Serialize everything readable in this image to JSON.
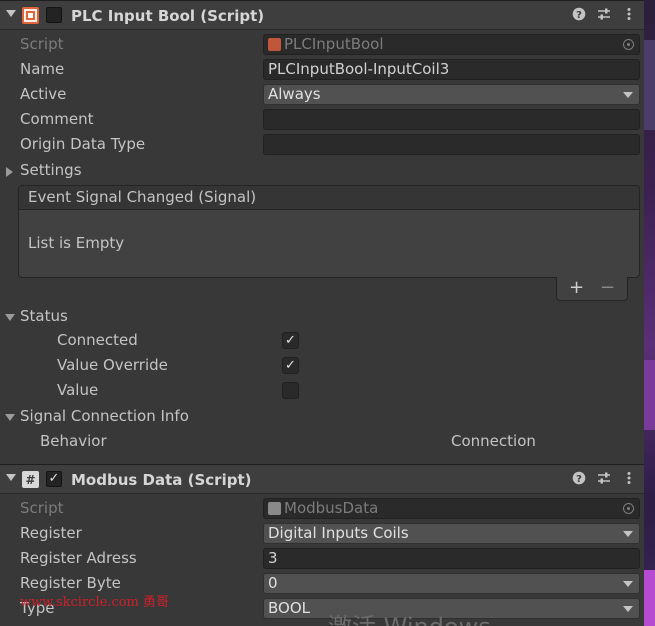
{
  "plc": {
    "title": "PLC Input Bool (Script)",
    "enabled": false,
    "fields": {
      "script_label": "Script",
      "script_value": "PLCInputBool",
      "name_label": "Name",
      "name_value": "PLCInputBool-InputCoil3",
      "active_label": "Active",
      "active_value": "Always",
      "comment_label": "Comment",
      "comment_value": "",
      "origin_label": "Origin Data Type",
      "origin_value": ""
    },
    "settings_label": "Settings",
    "event": {
      "header": "Event Signal Changed (Signal)",
      "empty_text": "List is Empty",
      "add_symbol": "+",
      "remove_symbol": "−"
    },
    "status": {
      "label": "Status",
      "connected_label": "Connected",
      "connected": true,
      "override_label": "Value Override",
      "override": true,
      "value_label": "Value",
      "value": false
    },
    "signal_info": {
      "label": "Signal Connection Info",
      "behavior_label": "Behavior",
      "connection_label": "Connection"
    }
  },
  "modbus": {
    "title": "Modbus Data (Script)",
    "enabled": true,
    "fields": {
      "script_label": "Script",
      "script_value": "ModbusData",
      "register_label": "Register",
      "register_value": "Digital Inputs Coils",
      "adress_label": "Register Adress",
      "adress_value": "3",
      "byte_label": "Register Byte",
      "byte_value": "0",
      "type_label": "Type",
      "type_value": "BOOL"
    }
  },
  "overlay": {
    "watermark": "www.skcircle.com 勇哥",
    "activate_text": "激活 Windows"
  },
  "icons": {
    "help": "help-icon",
    "presets": "presets-icon",
    "menu": "kebab-menu-icon",
    "check_glyph": "✓"
  },
  "colors": {
    "plc_icon": "#e0653a",
    "modbus_icon": "#d8d8d8",
    "background": "#383838",
    "watermark": "#d0202a"
  }
}
